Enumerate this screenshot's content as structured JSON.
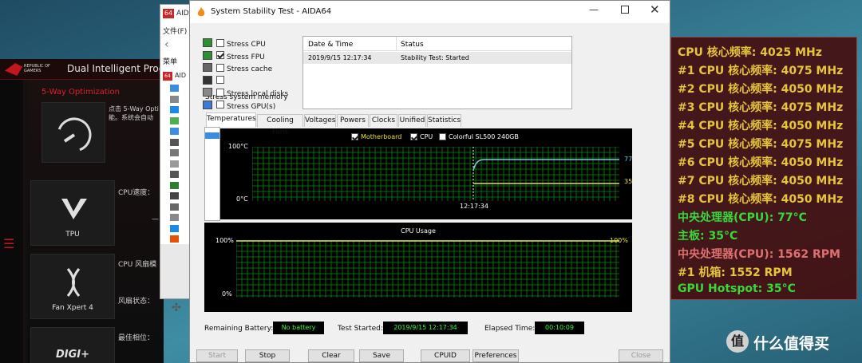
{
  "rog": {
    "brand_line1": "REPUBLIC OF",
    "brand_line2": "GAMERS",
    "title": "Dual Intelligent Proce",
    "five_way_label": "5-Way Optimization",
    "five_way_desc": "点击 5-Way Opti 能。系统会自动",
    "tiles": [
      {
        "label": "TPU",
        "caption": "CPU速度：",
        "caption_extra": "—"
      },
      {
        "label": "Fan Xpert 4",
        "caption": "CPU 风扇模",
        "caption2": "风扇状态："
      },
      {
        "label": "DIGI+",
        "caption": "最佳相位："
      }
    ],
    "menu_icon": "hamburger-icon"
  },
  "aida_main": {
    "icon_text": "64",
    "title": "AID",
    "menu_file": "文件(F)",
    "menu_label": "菜单",
    "tree_root": "AID"
  },
  "stab": {
    "title": "System Stability Test - AIDA64",
    "options": [
      {
        "label": "Stress CPU",
        "checked": false,
        "icon": "cpu-icon"
      },
      {
        "label": "Stress FPU",
        "checked": true,
        "icon": "fpu-icon"
      },
      {
        "label": "Stress cache",
        "checked": false,
        "icon": "cache-icon"
      },
      {
        "label": "Stress system memory",
        "checked": false,
        "icon": "memory-icon"
      },
      {
        "label": "Stress local disks",
        "checked": false,
        "icon": "disk-icon"
      },
      {
        "label": "Stress GPU(s)",
        "checked": false,
        "icon": "gpu-icon"
      }
    ],
    "log_headers": [
      "Date & Time",
      "Status"
    ],
    "log_rows": [
      {
        "datetime": "2019/9/15 12:17:34",
        "status": "Stability Test: Started"
      }
    ],
    "tabs": [
      "Temperatures",
      "Cooling Fans",
      "Voltages",
      "Powers",
      "Clocks",
      "Unified",
      "Statistics"
    ],
    "active_tab": "Temperatures",
    "temp_legend": [
      {
        "label": "Motherboard",
        "checked": true,
        "color": "#e8e040"
      },
      {
        "label": "CPU",
        "checked": true,
        "color": "#ffffff"
      },
      {
        "label": "Colorful SL500 240GB",
        "checked": false,
        "color": "#ffffff"
      }
    ],
    "temp_ymax": "100°C",
    "temp_ymin": "0°C",
    "temp_time": "12:17:34",
    "temp_val_cpu": "77",
    "temp_val_mb": "35",
    "cpu_usage_title": "CPU Usage",
    "cpu_ymax": "100%",
    "cpu_ymin": "0%",
    "cpu_value": "100%",
    "remaining_battery_label": "Remaining Battery:",
    "remaining_battery_value": "No battery",
    "test_started_label": "Test Started:",
    "test_started_value": "2019/9/15 12:17:34",
    "elapsed_label": "Elapsed Time:",
    "elapsed_value": "00:10:09",
    "buttons": {
      "start": "Start",
      "stop": "Stop",
      "clear": "Clear",
      "save": "Save",
      "cpuid": "CPUID",
      "preferences": "Preferences",
      "close": "Close"
    }
  },
  "osd": {
    "lines": [
      {
        "text": "CPU 核心频率: 4025 MHz",
        "color": "#e6c53a"
      },
      {
        "text": "#1 CPU 核心频率: 4075 MHz",
        "color": "#e6c53a"
      },
      {
        "text": "#2 CPU 核心频率: 4050 MHz",
        "color": "#e6c53a"
      },
      {
        "text": "#3 CPU 核心频率: 4075 MHz",
        "color": "#e6c53a"
      },
      {
        "text": "#4 CPU 核心频率: 4050 MHz",
        "color": "#e6c53a"
      },
      {
        "text": "#5 CPU 核心频率: 4075 MHz",
        "color": "#e6c53a"
      },
      {
        "text": "#6 CPU 核心频率: 4050 MHz",
        "color": "#e6c53a"
      },
      {
        "text": "#7 CPU 核心频率: 4050 MHz",
        "color": "#e6c53a"
      },
      {
        "text": "#8 CPU 核心频率: 4050 MHz",
        "color": "#e6c53a"
      },
      {
        "text": "中央处理器(CPU): 77°C",
        "color": "#38d838"
      },
      {
        "text": "主板: 35°C",
        "color": "#38d838"
      },
      {
        "text": "中央处理器(CPU): 1562 RPM",
        "color": "#e07070"
      },
      {
        "text": "#1 机箱: 1552 RPM",
        "color": "#e6c53a"
      },
      {
        "text": "GPU Hotspot: 35°C",
        "color": "#38d838"
      }
    ]
  },
  "watermark": "值 什么值得买"
}
